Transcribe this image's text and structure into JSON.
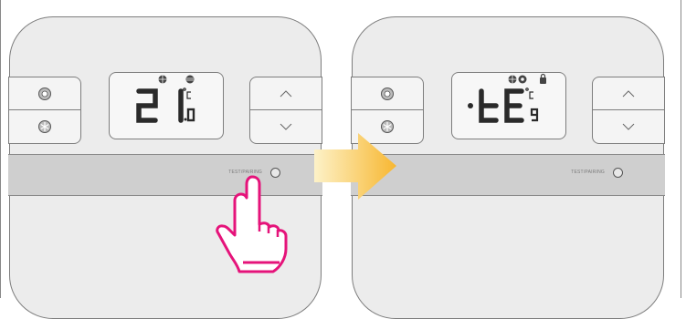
{
  "step_before": {
    "display": {
      "digits": "21",
      "decimal": ".0",
      "unit": "°C"
    },
    "strip_label": "TEST/PAIRING"
  },
  "step_after": {
    "display": {
      "code": "tE",
      "sub": "9",
      "unit": "°C"
    },
    "strip_label": "TEST/PAIRING"
  },
  "icons": {
    "sun": "sun-icon",
    "snowflake": "snowflake-icon",
    "up": "chevron-up-icon",
    "down": "chevron-down-icon",
    "hand": "pointing-hand-icon",
    "arrow": "right-arrow-icon"
  },
  "colors": {
    "hand_outline": "#e5137a",
    "arrow_start": "#fdf2c8",
    "arrow_end": "#f7b731"
  }
}
